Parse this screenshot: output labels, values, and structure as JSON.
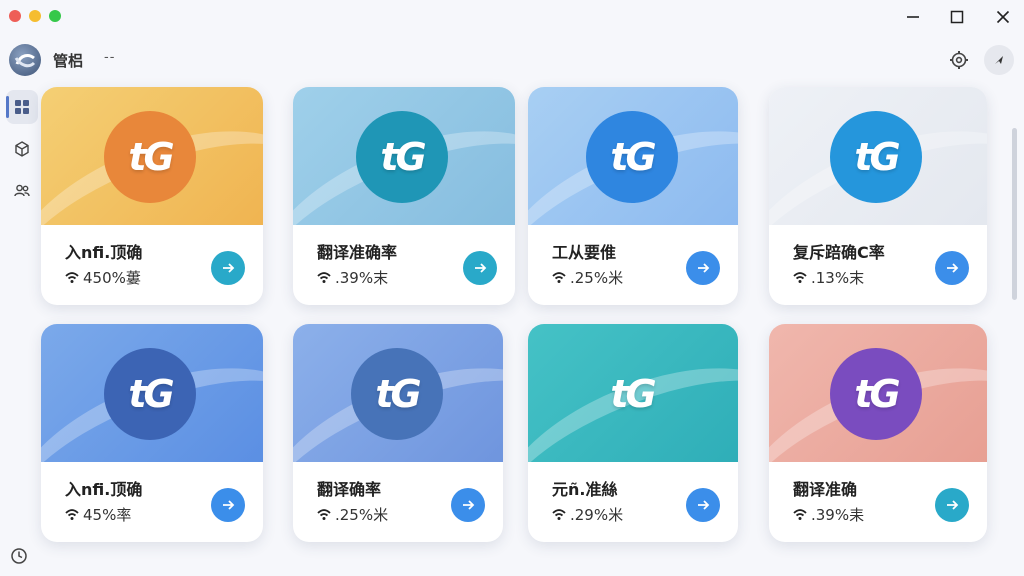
{
  "header": {
    "title": "管梠",
    "subtitle": "--",
    "logo_icon": "app-logo-icon",
    "settings_icon": "gear-icon",
    "user_icon": "navigation-arrow-icon"
  },
  "window_controls": {
    "minimize_icon": "minimize-icon",
    "maximize_icon": "maximize-icon",
    "close_icon": "close-icon"
  },
  "sidebar": {
    "items": [
      {
        "icon": "dashboard-grid-icon",
        "active": true
      },
      {
        "icon": "cube-icon",
        "active": false
      },
      {
        "icon": "users-icon",
        "active": false
      }
    ],
    "footer_icon": "clock-icon"
  },
  "colors": {
    "accent": "#5578c8",
    "badge_orange": "#e8873a",
    "badge_teal": "#1f96b6",
    "badge_blue": "#2f86e0",
    "badge_sky": "#2596dc",
    "badge_navy": "#3c64b4",
    "badge_steel": "#4773b8",
    "badge_purple": "#7a4cbf",
    "button_teal": "#29a9c9",
    "button_blue": "#3b8eea"
  },
  "cards": [
    {
      "logo_text": "tG",
      "title": "入nfi.顶确",
      "stat": "450%蔞"
    },
    {
      "logo_text": "tG",
      "title": "翻译准确率",
      "stat": ".39%末"
    },
    {
      "logo_text": "tG",
      "title": "工从要倠",
      "stat": ".25%米"
    },
    {
      "logo_text": "tG",
      "title": "复斥踣确C率",
      "stat": ".13%末"
    },
    {
      "logo_text": "tG",
      "title": "入nfi.顶确",
      "stat": "45%率"
    },
    {
      "logo_text": "tG",
      "title": "翻译确率",
      "stat": ".25%米"
    },
    {
      "logo_text": "tG",
      "title": "元ñ.准絲",
      "stat": ".29%米"
    },
    {
      "logo_text": "tG",
      "title": "翻译准确",
      "stat": ".39%耒"
    }
  ]
}
